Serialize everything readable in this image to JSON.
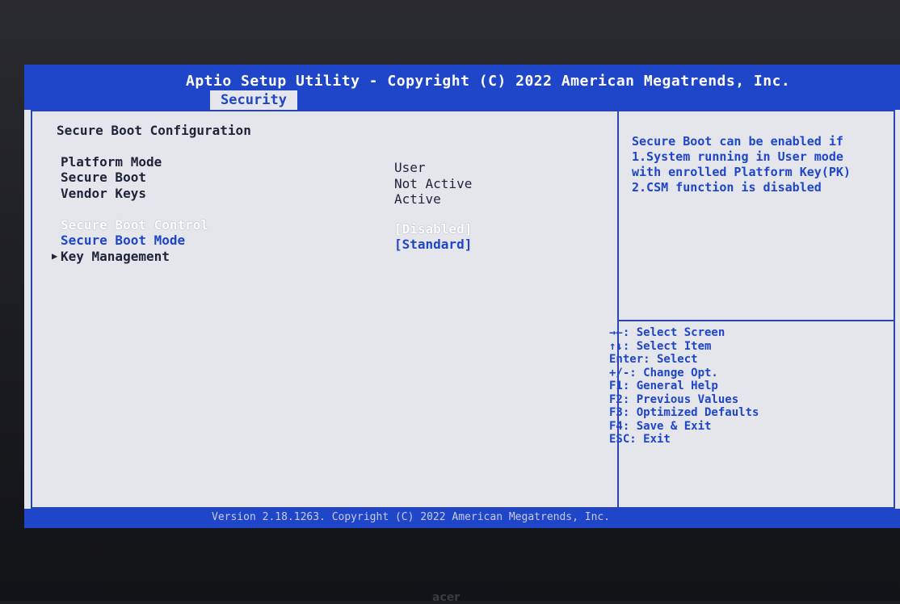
{
  "header": {
    "title": "Aptio Setup Utility - Copyright (C) 2022 American Megatrends, Inc.",
    "active_tab": "Security"
  },
  "main": {
    "section_title": "Secure Boot Configuration",
    "info_rows": [
      {
        "label": "Platform Mode",
        "value": "User"
      },
      {
        "label": "Secure Boot",
        "value": "Not Active"
      },
      {
        "label": "Vendor Keys",
        "value": "Active"
      }
    ],
    "options": [
      {
        "label": "Secure Boot Control",
        "value": "[Disabled]",
        "selected": true
      },
      {
        "label": "Secure Boot Mode",
        "value": "[Standard]",
        "selected": false
      }
    ],
    "submenu": {
      "label": "Key Management"
    }
  },
  "help": {
    "lines": [
      "Secure Boot can be enabled if",
      "1.System running in User mode",
      "with enrolled Platform Key(PK)",
      "2.CSM function is disabled"
    ]
  },
  "keys": [
    "→←: Select Screen",
    "↑↓: Select Item",
    "Enter: Select",
    "+/-: Change Opt.",
    "F1: General Help",
    "F2: Previous Values",
    "F3: Optimized Defaults",
    "F4: Save & Exit",
    "ESC: Exit"
  ],
  "footer": {
    "text": "Version 2.18.1263. Copyright (C) 2022 American Megatrends, Inc."
  },
  "bezel": {
    "brand": "acer"
  },
  "colors": {
    "bios_blue": "#1f45c8",
    "panel_bg": "#e4e6ec",
    "text_dark": "#20243a",
    "selected_text": "#ffffff"
  }
}
